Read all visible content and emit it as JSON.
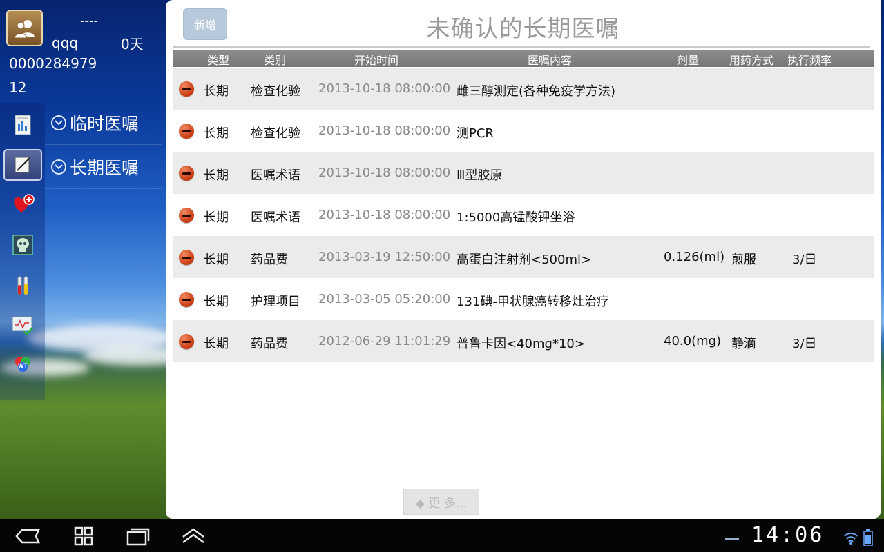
{
  "user": {
    "name_dashes": "----",
    "username": "qqq",
    "days": "0天",
    "patient_id": "0000284979",
    "bed": "12"
  },
  "menu": [
    {
      "label": "临时医嘱"
    },
    {
      "label": "长期医嘱"
    }
  ],
  "rail_icons": [
    "report-icon",
    "edit-orders-icon",
    "heart-plus-icon",
    "skull-xray-icon",
    "test-tubes-icon",
    "monitor-check-icon",
    "wt-icon"
  ],
  "header": {
    "add_label": "新增",
    "title": "未确认的长期医嘱"
  },
  "table": {
    "columns": [
      "类型",
      "类别",
      "开始时间",
      "医嘱内容",
      "剂量",
      "用药方式",
      "执行频率"
    ],
    "rows": [
      {
        "type": "长期",
        "category": "检查化验",
        "start": "2013-10-18 08:00:00",
        "content": "雌三醇测定(各种免疫学方法)",
        "dose": "",
        "route": "",
        "freq": ""
      },
      {
        "type": "长期",
        "category": "检查化验",
        "start": "2013-10-18 08:00:00",
        "content": "测PCR",
        "dose": "",
        "route": "",
        "freq": ""
      },
      {
        "type": "长期",
        "category": "医嘱术语",
        "start": "2013-10-18 08:00:00",
        "content": "Ⅲ型胶原",
        "dose": "",
        "route": "",
        "freq": ""
      },
      {
        "type": "长期",
        "category": "医嘱术语",
        "start": "2013-10-18 08:00:00",
        "content": "1:5000高锰酸钾坐浴",
        "dose": "",
        "route": "",
        "freq": ""
      },
      {
        "type": "长期",
        "category": "药品费",
        "start": "2013-03-19 12:50:00",
        "content": "高蛋白注射剂<500ml>",
        "dose": "0.126(ml)",
        "route": "煎服",
        "freq": "3/日"
      },
      {
        "type": "长期",
        "category": "护理项目",
        "start": "2013-03-05 05:20:00",
        "content": "131碘-甲状腺癌转移灶治疗",
        "dose": "",
        "route": "",
        "freq": ""
      },
      {
        "type": "长期",
        "category": "药品费",
        "start": "2012-06-29 11:01:29",
        "content": "普鲁卡因<40mg*10>",
        "dose": "40.0(mg)",
        "route": "静滴",
        "freq": "3/日"
      }
    ]
  },
  "more_label": "◆ 更 多...",
  "status": {
    "time": "14:06"
  },
  "colors": {
    "row_alt": "#ebebeb",
    "header_bg": "#808080",
    "delete_red": "#d9471a",
    "add_button": "#b7c9db"
  }
}
